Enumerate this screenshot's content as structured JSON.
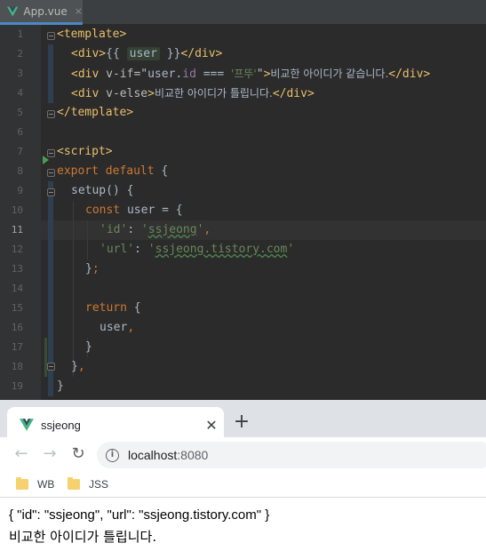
{
  "ide": {
    "tab": {
      "label": "App.vue",
      "close": "×"
    },
    "line_numbers": [
      "1",
      "2",
      "3",
      "4",
      "5",
      "6",
      "7",
      "8",
      "9",
      "10",
      "11",
      "12",
      "13",
      "14",
      "15",
      "16",
      "17",
      "18",
      "19"
    ],
    "active_line": "11",
    "code": {
      "l1": {
        "t1": "<template>"
      },
      "l2": {
        "t1": "<div>",
        "t2": "{{ ",
        "t3": "user",
        "t4": " }}",
        "t5": "</div>"
      },
      "l3": {
        "t1": "<div ",
        "t2": "v-if=\"",
        "t3": "user",
        "t4": ".",
        "t5": "id",
        "t6": " === ",
        "t7": "'프뚜'",
        "t8": "\"",
        "t9": ">",
        "t10": "비교한 아이디가 같습니다.",
        "t11": "</div>"
      },
      "l4": {
        "t1": "<div ",
        "t2": "v-else",
        "t3": ">",
        "t4": "비교한 아이디가 틀립니다.",
        "t5": "</div>"
      },
      "l5": {
        "t1": "</template>"
      },
      "l7": {
        "t1": "<script>"
      },
      "l8": {
        "t1": "export default",
        "t2": " {"
      },
      "l9": {
        "t1": "setup",
        "t2": "() {"
      },
      "l10": {
        "t1": "const ",
        "t2": "user",
        "t3": " = {"
      },
      "l11": {
        "t1": "'id'",
        "t2": ": ",
        "t3": "'",
        "t4": "ssjeong",
        "t5": "'",
        "t6": ","
      },
      "l12": {
        "t1": "'url'",
        "t2": ": ",
        "t3": "'",
        "t4": "ssjeong.tistory.com",
        "t5": "'"
      },
      "l13": {
        "t1": "}",
        "t2": ";"
      },
      "l15": {
        "t1": "return",
        "t2": " {"
      },
      "l16": {
        "t1": "user",
        "t2": ","
      },
      "l17": {
        "t1": "}"
      },
      "l18": {
        "t1": "}",
        "t2": ","
      },
      "l19": {
        "t1": "}"
      }
    }
  },
  "browser": {
    "tab_title": "ssjeong",
    "tab_close": "✕",
    "new_tab": "+",
    "back": "←",
    "forward": "→",
    "reload": "↻",
    "info": "i",
    "url_host": "localhost",
    "url_port": ":8080",
    "bookmarks": [
      {
        "label": "WB"
      },
      {
        "label": "JSS"
      }
    ],
    "output": {
      "line1": "{ \"id\": \"ssjeong\", \"url\": \"ssjeong.tistory.com\" }",
      "line2": "비교한 아이디가 틀립니다."
    }
  },
  "colors": {
    "vue_green": "#41b883",
    "vue_dark": "#35495e",
    "editor_bg": "#2b2b2b",
    "tag": "#e8bf6a",
    "string": "#6a8759",
    "keyword": "#cc7832",
    "property": "#9876aa"
  }
}
